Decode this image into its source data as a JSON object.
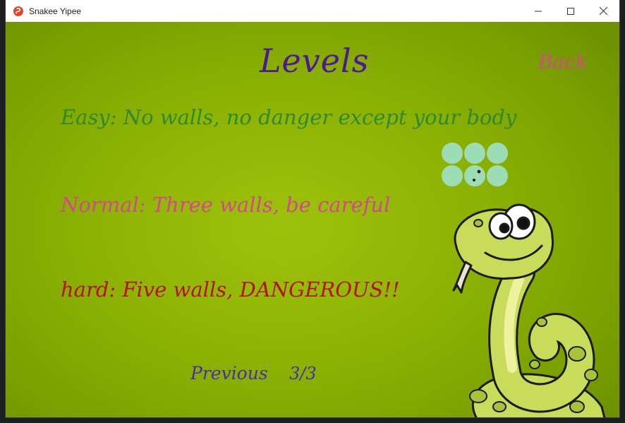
{
  "window": {
    "title": "Snakee Yipee",
    "app_icon": "snake-app-icon",
    "controls": [
      "minimize-icon",
      "maximize-icon",
      "close-icon"
    ]
  },
  "screen": {
    "heading": "Levels",
    "back_label": "Back",
    "levels": [
      {
        "text": "Easy: No walls, no danger except your body",
        "color": "#2f8a2f"
      },
      {
        "text": "Normal: Three walls, be careful",
        "color": "#d44a86"
      },
      {
        "text": "hard: Five walls, DANGEROUS!!",
        "color": "#b3131a"
      }
    ],
    "previous_label": "Previous",
    "page_indicator": "3/3"
  },
  "colors": {
    "background": "#8db205",
    "heading": "#4b1a8f",
    "back": "#d24a8c",
    "nav": "#4b2fa0",
    "snake_segment": "#9ee0c0"
  }
}
